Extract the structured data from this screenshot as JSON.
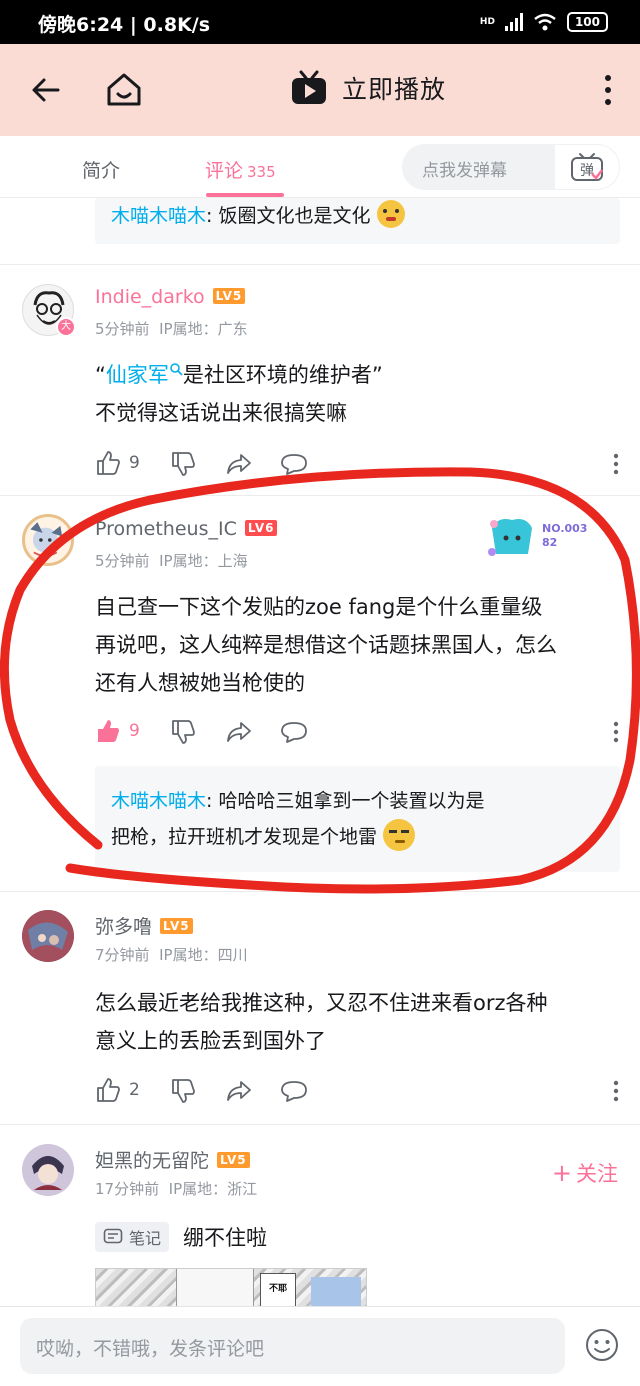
{
  "status_bar": {
    "time_speed": "傍晚6:24 | 0.8K/s",
    "network": "HD",
    "battery": "100"
  },
  "app_bar": {
    "play_label": "立即播放",
    "icons": [
      "back-arrow-icon",
      "home-icon",
      "tv-play-icon",
      "more-vertical-icon"
    ]
  },
  "tabs": {
    "intro": "简介",
    "comments": "评论",
    "comments_count": "335",
    "danmaku_placeholder": "点我发弹幕",
    "danmaku_button": "弹"
  },
  "top_reply": {
    "name": "木喵木喵木",
    "text": ": 饭圈文化也是文化"
  },
  "comments": [
    {
      "username": "Indie_darko",
      "level": "LV5",
      "badge": "大",
      "time": "5分钟前",
      "ip": "IP属地：广东",
      "line1_open": "“",
      "line1_link": "仙家军",
      "line1_rest": "是社区环境的维护者”",
      "line2": "不觉得这话说出来很搞笑嘛",
      "likes": "9"
    },
    {
      "username": "Prometheus_IC",
      "level": "LV6",
      "time": "5分钟前",
      "ip": "IP属地：上海",
      "fan_badge": "NO.00382",
      "line1": "自己查一下这个发贴的zoe fang是个什么重量级",
      "line2": "再说吧，这人纯粹是想借这个话题抹黑国人，怎么",
      "line3": "还有人想被她当枪使的",
      "likes": "9",
      "reply": {
        "name": "木喵木喵木",
        "line1": ": 哈哈哈三姐拿到一个装置以为是",
        "line2": "把枪，拉开班机才发现是个地雷"
      }
    },
    {
      "username": "弥多噜",
      "level": "LV5",
      "time": "7分钟前",
      "ip": "IP属地：四川",
      "line1": "怎么最近老给我推这种，又忍不住进来看orz各种",
      "line2": "意义上的丢脸丢到国外了",
      "likes": "2"
    },
    {
      "username": "妲黑的无留陀",
      "level": "LV5",
      "time": "17分钟前",
      "ip": "IP属地：浙江",
      "follow": "关注",
      "note_tag": "笔记",
      "text": "绷不住啦",
      "image_text": "不耶"
    }
  ],
  "bottom_bar": {
    "placeholder": "哎呦，不错哦，发条评论吧"
  },
  "colors": {
    "accent_pink": "#fb7299",
    "link_blue": "#00aeec",
    "app_bar_bg": "#fbdcd5",
    "annotation_red": "#e8281e"
  }
}
